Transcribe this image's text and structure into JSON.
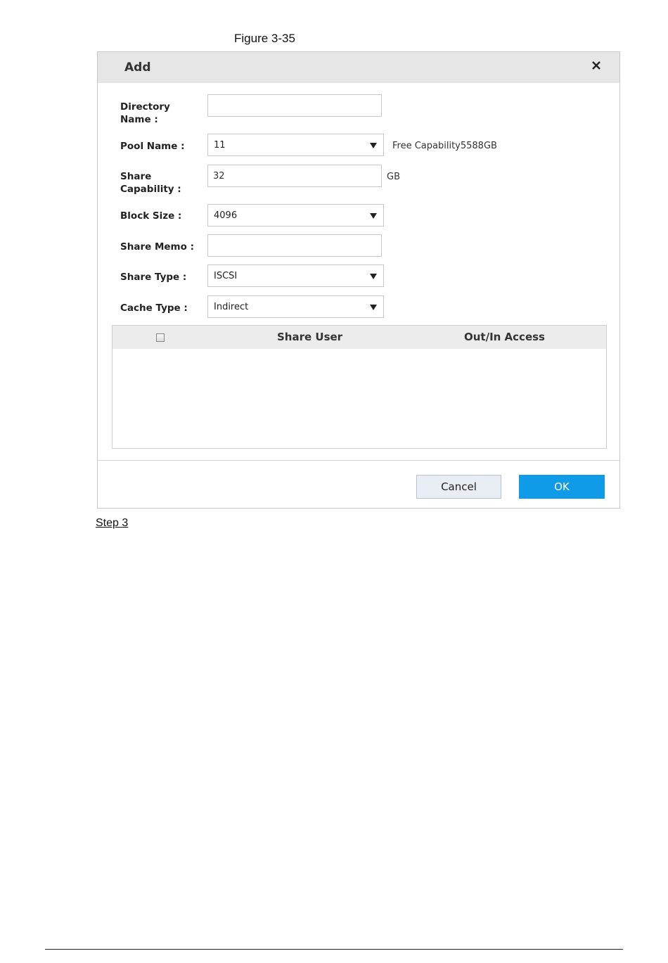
{
  "caption": "Figure 3-35",
  "dialog": {
    "title": "Add",
    "fields": {
      "directory_name_label": "Directory Name :",
      "directory_name_value": "",
      "pool_name_label": "Pool Name :",
      "pool_name_value": "11",
      "free_capability": "Free Capability5588GB",
      "share_capability_label": "Share Capability :",
      "share_capability_value": "32",
      "share_capability_unit": "GB",
      "block_size_label": "Block Size :",
      "block_size_value": "4096",
      "share_memo_label": "Share Memo :",
      "share_memo_value": "",
      "share_type_label": "Share Type :",
      "share_type_value": "ISCSI",
      "cache_type_label": "Cache Type :",
      "cache_type_value": "Indirect"
    },
    "table": {
      "columns": [
        "Share User",
        "Out/In Access"
      ],
      "rows": []
    },
    "buttons": {
      "cancel": "Cancel",
      "ok": "OK"
    }
  },
  "step_label": "Step 3",
  "colors": {
    "header_bg": "#e6e6e6",
    "ok_button": "#0f9be8",
    "cancel_button": "#e8eef4"
  }
}
